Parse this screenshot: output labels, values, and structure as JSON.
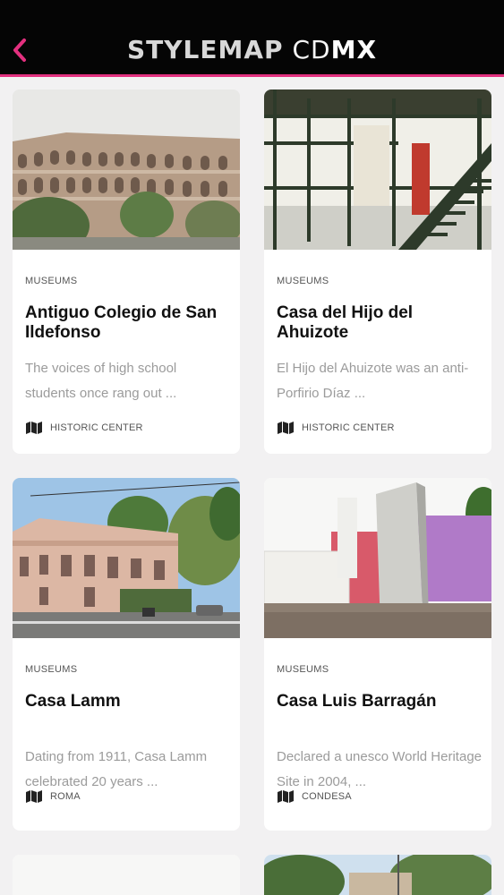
{
  "header": {
    "title_part1": "STYLEMAP",
    "title_part2": "CD",
    "title_part3": "MX",
    "accent_color": "#e3307f"
  },
  "cards": [
    {
      "category": "MUSEUMS",
      "name": "Antiguo Colegio de San Ildefonso",
      "description": "The voices of high school students once rang out ...",
      "location": "HISTORIC CENTER",
      "location_icon": "map-icon"
    },
    {
      "category": "MUSEUMS",
      "name": "Casa del Hijo del Ahuizote",
      "description": "El Hijo del Ahuizote was an anti-Porfirio Díaz ...",
      "location": "HISTORIC CENTER",
      "location_icon": "map-icon"
    },
    {
      "category": "MUSEUMS",
      "name": "Casa Lamm",
      "description": "Dating from 1911, Casa Lamm celebrated 20 years ...",
      "location": "ROMA",
      "location_icon": "map-icon"
    },
    {
      "category": "MUSEUMS",
      "name": "Casa Luis Barragán",
      "description": "Declared a unesco World Heritage Site in 2004, ...",
      "location": "CONDESA",
      "location_icon": "map-icon"
    }
  ]
}
